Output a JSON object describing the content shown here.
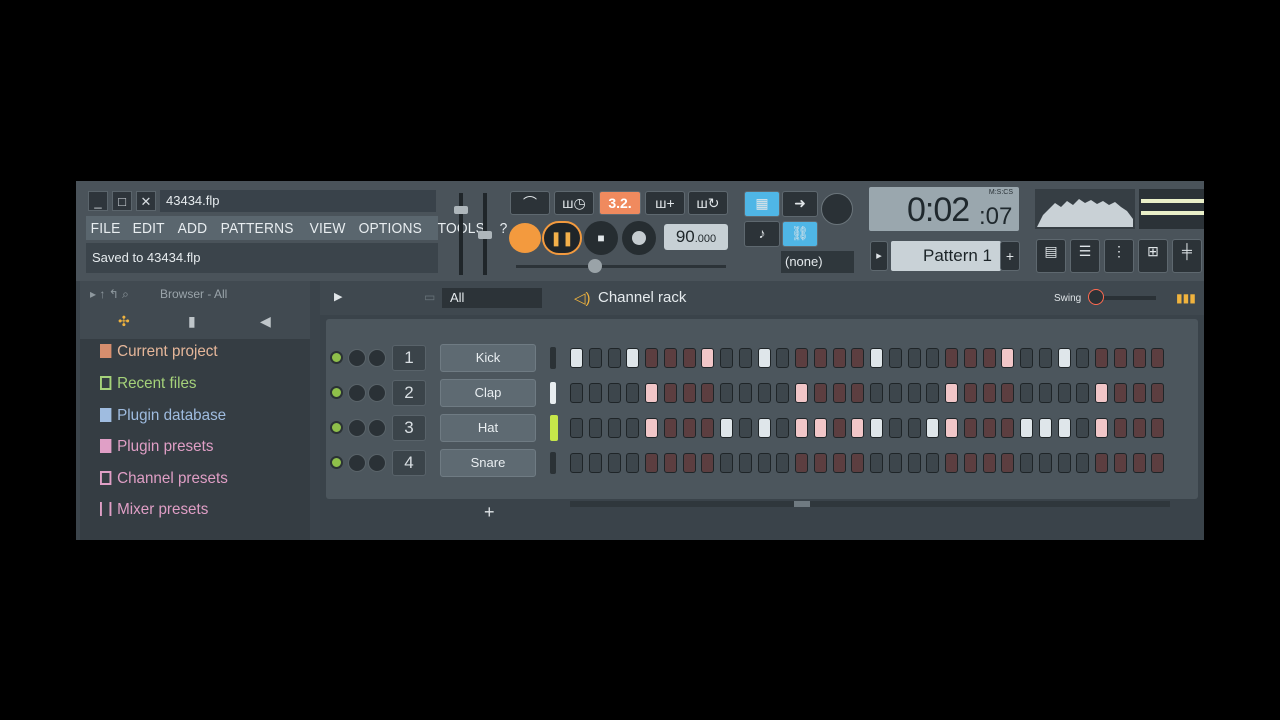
{
  "window": {
    "filename": "43434.flp",
    "status": "Saved to 43434.flp",
    "controls": [
      "_",
      "□",
      "✕"
    ]
  },
  "menu": [
    "FILE",
    "EDIT",
    "ADD",
    "PATTERNS",
    "VIEW",
    "OPTIONS",
    "TOOLS",
    "?"
  ],
  "transport": {
    "pattern_mode_label": "3.2.",
    "tempo_main": "90",
    "tempo_frac": ".000",
    "time_main": "0:02",
    "time_cs": ":07",
    "time_unit": "M:S:CS",
    "pattern_name": "Pattern 1",
    "pattern_add": "+",
    "output_select": "(none)"
  },
  "browser": {
    "title": "Browser - All",
    "items": [
      {
        "label": "Current project",
        "color": "#e6b79a"
      },
      {
        "label": "Recent files",
        "color": "#a5d27a"
      },
      {
        "label": "Plugin database",
        "color": "#9fbce0"
      },
      {
        "label": "Plugin presets",
        "color": "#e09fc6"
      },
      {
        "label": "Channel presets",
        "color": "#e09fc6"
      },
      {
        "label": "Mixer presets",
        "color": "#e09fc6"
      }
    ]
  },
  "rack": {
    "title": "Channel rack",
    "filter": "All",
    "swing_label": "Swing",
    "add_label": "+",
    "channels": [
      {
        "num": "1",
        "name": "Kick",
        "steps": [
          1,
          0,
          0,
          1,
          0,
          0,
          0,
          1,
          0,
          0,
          1,
          0,
          0,
          0,
          0,
          0,
          1,
          0,
          0,
          0,
          0,
          0,
          0,
          1,
          0,
          0,
          1,
          0,
          0,
          0,
          0,
          0
        ]
      },
      {
        "num": "2",
        "name": "Clap",
        "steps": [
          0,
          0,
          0,
          0,
          1,
          0,
          0,
          0,
          0,
          0,
          0,
          0,
          1,
          0,
          0,
          0,
          0,
          0,
          0,
          0,
          1,
          0,
          0,
          0,
          0,
          0,
          0,
          0,
          1,
          0,
          0,
          0
        ]
      },
      {
        "num": "3",
        "name": "Hat",
        "steps": [
          0,
          0,
          0,
          0,
          1,
          0,
          0,
          0,
          1,
          0,
          1,
          0,
          1,
          1,
          0,
          1,
          1,
          0,
          0,
          1,
          1,
          0,
          0,
          0,
          1,
          1,
          1,
          0,
          1,
          0,
          0,
          0
        ]
      },
      {
        "num": "4",
        "name": "Snare",
        "steps": [
          0,
          0,
          0,
          0,
          0,
          0,
          0,
          0,
          0,
          0,
          0,
          0,
          0,
          0,
          0,
          0,
          0,
          0,
          0,
          0,
          0,
          0,
          0,
          0,
          0,
          0,
          0,
          0,
          0,
          0,
          0,
          0
        ]
      }
    ]
  }
}
